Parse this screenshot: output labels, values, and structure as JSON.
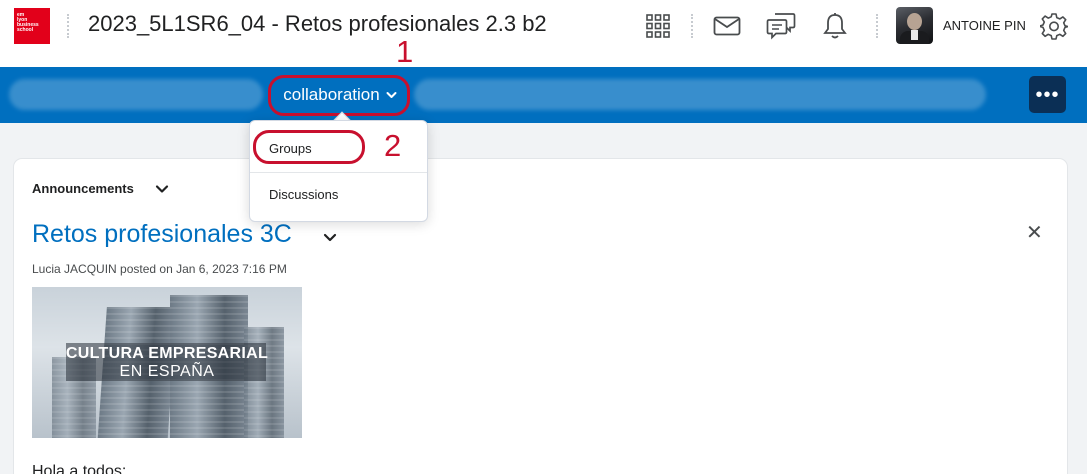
{
  "header": {
    "logo": {
      "lines": [
        "em",
        "lyon",
        "business",
        "school"
      ],
      "color": "#e2001a"
    },
    "course_title": "2023_5L1SR6_04 - Retos profesionales 2.3 b2",
    "icons": [
      "app-grid-icon",
      "mail-icon",
      "chat-icon",
      "bell-icon",
      "gear-icon"
    ],
    "user_name": "ANTOINE PIN"
  },
  "navbar": {
    "background": "#006fbf",
    "collaboration_label": "collaboration",
    "more_label": "•••"
  },
  "dropdown": {
    "items": [
      {
        "label": "Groups"
      },
      {
        "label": "Discussions"
      }
    ]
  },
  "annotations": {
    "step1": "1",
    "step2": "2",
    "color": "#c8102e"
  },
  "announcements": {
    "heading": "Announcements",
    "post": {
      "title": "Retos profesionales 3C",
      "meta": "Lucia JACQUIN posted on Jan 6, 2023 7:16 PM",
      "image_text_line1": "CULTURA EMPRESARIAL",
      "image_text_line2": "EN ESPAÑA",
      "body_start": "Hola a todos:"
    },
    "close_label": "✕"
  }
}
